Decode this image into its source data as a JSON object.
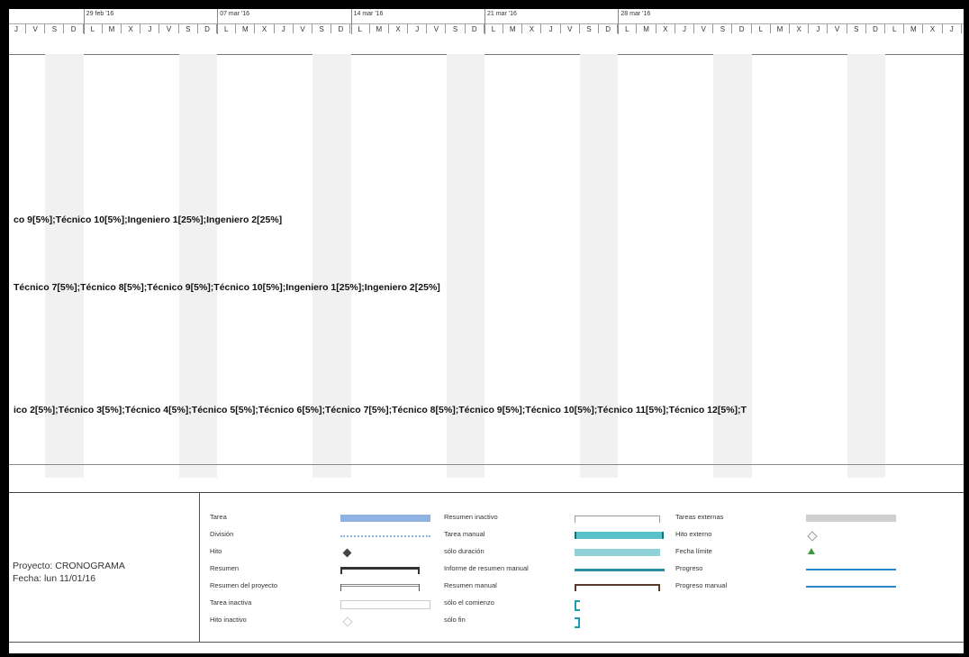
{
  "timescale": {
    "weeks": [
      "29 feb '16",
      "07 mar '16",
      "14 mar '16",
      "21 mar '16",
      "28 mar '16"
    ],
    "days": [
      "J",
      "V",
      "S",
      "D",
      "L",
      "M",
      "X",
      "J",
      "V",
      "S",
      "D",
      "L",
      "M",
      "X",
      "J",
      "V",
      "S",
      "D",
      "L",
      "M",
      "X",
      "J",
      "V",
      "S",
      "D",
      "L",
      "M",
      "X",
      "J",
      "V",
      "S",
      "D",
      "L",
      "M",
      "X",
      "J",
      "V",
      "S",
      "D",
      "L",
      "M",
      "X",
      "J",
      "V",
      "S",
      "D",
      "L",
      "M",
      "X",
      "J",
      "V"
    ]
  },
  "resources": [
    "co 9[5%];Técnico 10[5%];Ingeniero 1[25%];Ingeniero 2[25%]",
    "Técnico 7[5%];Técnico 8[5%];Técnico 9[5%];Técnico 10[5%];Ingeniero 1[25%];Ingeniero 2[25%]",
    "ico 2[5%];Técnico 3[5%];Técnico 4[5%];Técnico 5[5%];Técnico 6[5%];Técnico 7[5%];Técnico 8[5%];Técnico 9[5%];Técnico 10[5%];Técnico 11[5%];Técnico 12[5%];T"
  ],
  "project": {
    "name_line": "Proyecto: CRONOGRAMA",
    "date_line": "Fecha: lun 11/01/16"
  },
  "legend": {
    "col1": [
      {
        "label": "Tarea",
        "symbol": "task-bar"
      },
      {
        "label": "División",
        "symbol": "split-line"
      },
      {
        "label": "Hito",
        "symbol": "milestone-diamond"
      },
      {
        "label": "Resumen",
        "symbol": "summary-bar"
      },
      {
        "label": "Resumen del proyecto",
        "symbol": "project-summary-bar"
      },
      {
        "label": "Tarea inactiva",
        "symbol": "inactive-task-bar"
      },
      {
        "label": "Hito inactivo",
        "symbol": "inactive-milestone"
      }
    ],
    "col2": [
      {
        "label": "Resumen inactivo",
        "symbol": "inactive-summary-bar"
      },
      {
        "label": "Tarea manual",
        "symbol": "manual-task-bar"
      },
      {
        "label": "sólo duración",
        "symbol": "duration-only-bar"
      },
      {
        "label": "Informe de resumen manual",
        "symbol": "manual-summary-rollup"
      },
      {
        "label": "Resumen manual",
        "symbol": "manual-summary-bar"
      },
      {
        "label": "sólo el comienzo",
        "symbol": "start-only-bracket"
      },
      {
        "label": "sólo fin",
        "symbol": "finish-only-bracket"
      }
    ],
    "col3": [
      {
        "label": "Tareas externas",
        "symbol": "external-task-bar"
      },
      {
        "label": "Hito externo",
        "symbol": "external-milestone"
      },
      {
        "label": "Fecha límite",
        "symbol": "deadline-arrow"
      },
      {
        "label": "Progreso",
        "symbol": "progress-line"
      },
      {
        "label": "Progreso manual",
        "symbol": "manual-progress-line"
      }
    ]
  },
  "colors": {
    "task": "#8fb4e3",
    "manual_task": "#5bc1c9",
    "progress": "#2e86c8",
    "deadline": "#3a9a3a",
    "external": "#cfcfcf"
  }
}
